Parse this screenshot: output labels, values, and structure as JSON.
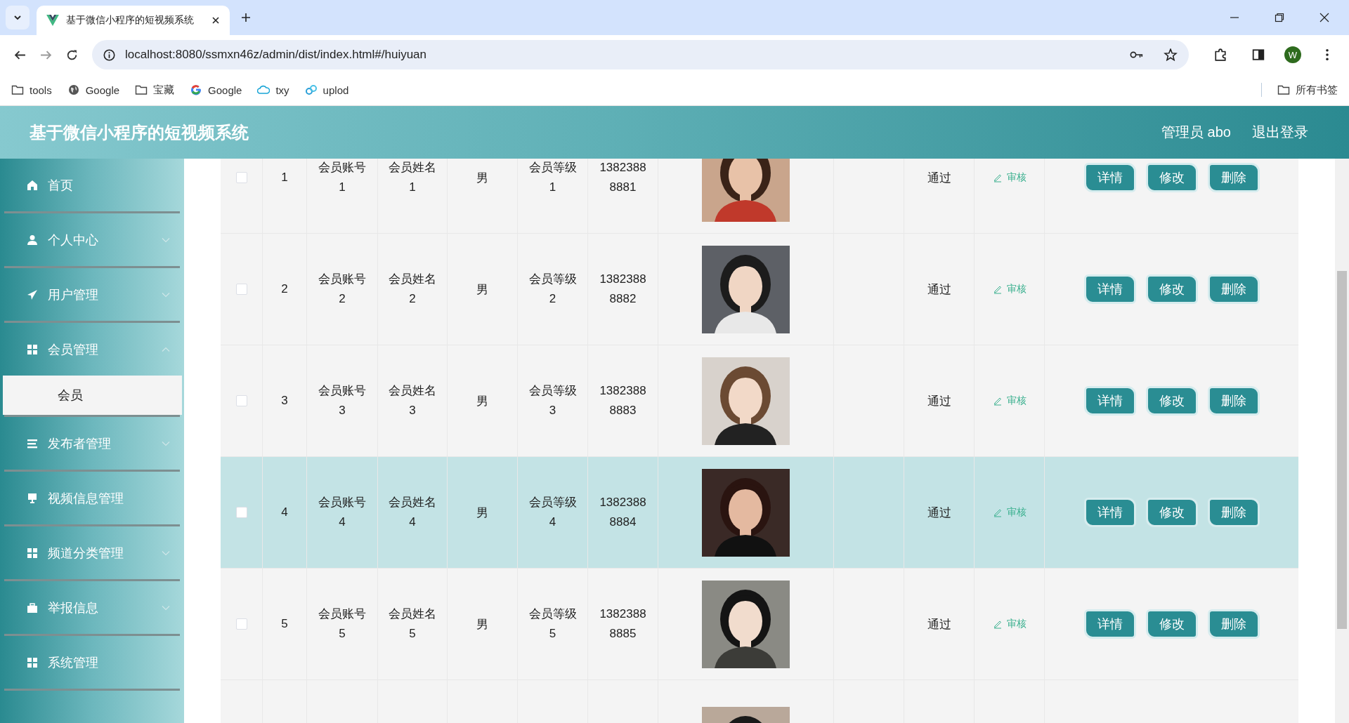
{
  "browser": {
    "tab_title": "基于微信小程序的短视频系统",
    "url": "localhost:8080/ssmxn46z/admin/dist/index.html#/huiyuan",
    "profile_initial": "W",
    "bookmarks": [
      {
        "kind": "folder",
        "label": "tools"
      },
      {
        "kind": "globe",
        "label": "Google"
      },
      {
        "kind": "folder",
        "label": "宝藏"
      },
      {
        "kind": "google",
        "label": "Google"
      },
      {
        "kind": "cloud",
        "label": "txy"
      },
      {
        "kind": "link",
        "label": "uplod"
      }
    ],
    "all_bookmarks": "所有书签"
  },
  "header": {
    "title": "基于微信小程序的短视频系统",
    "user": "管理员 abo",
    "logout": "退出登录"
  },
  "sidebar": {
    "items": [
      {
        "label": "首页"
      },
      {
        "label": "个人中心",
        "expanded": false
      },
      {
        "label": "用户管理",
        "expanded": false
      },
      {
        "label": "会员管理",
        "expanded": true,
        "children": [
          {
            "label": "会员",
            "selected": true
          }
        ]
      },
      {
        "label": "发布者管理",
        "expanded": false
      },
      {
        "label": "视频信息管理"
      },
      {
        "label": "频道分类管理",
        "expanded": false
      },
      {
        "label": "举报信息",
        "expanded": false
      },
      {
        "label": "系统管理"
      }
    ]
  },
  "table": {
    "rows": [
      {
        "checked": false,
        "highlighted": false,
        "index": "1",
        "account": "会员账号1",
        "name": "会员姓名1",
        "gender": "男",
        "level": "会员等级1",
        "phone": "13823888881",
        "status": "通过",
        "audit": "审核",
        "actions": [
          "详情",
          "修改",
          "删除"
        ]
      },
      {
        "checked": false,
        "highlighted": false,
        "index": "2",
        "account": "会员账号2",
        "name": "会员姓名2",
        "gender": "男",
        "level": "会员等级2",
        "phone": "13823888882",
        "status": "通过",
        "audit": "审核",
        "actions": [
          "详情",
          "修改",
          "删除"
        ]
      },
      {
        "checked": false,
        "highlighted": false,
        "index": "3",
        "account": "会员账号3",
        "name": "会员姓名3",
        "gender": "男",
        "level": "会员等级3",
        "phone": "13823888883",
        "status": "通过",
        "audit": "审核",
        "actions": [
          "详情",
          "修改",
          "删除"
        ]
      },
      {
        "checked": false,
        "highlighted": true,
        "index": "4",
        "account": "会员账号4",
        "name": "会员姓名4",
        "gender": "男",
        "level": "会员等级4",
        "phone": "13823888884",
        "status": "通过",
        "audit": "审核",
        "actions": [
          "详情",
          "修改",
          "删除"
        ]
      },
      {
        "checked": false,
        "highlighted": false,
        "index": "5",
        "account": "会员账号5",
        "name": "会员姓名5",
        "gender": "男",
        "level": "会员等级5",
        "phone": "13823888885",
        "status": "通过",
        "audit": "审核",
        "actions": [
          "详情",
          "修改",
          "删除"
        ]
      }
    ]
  }
}
